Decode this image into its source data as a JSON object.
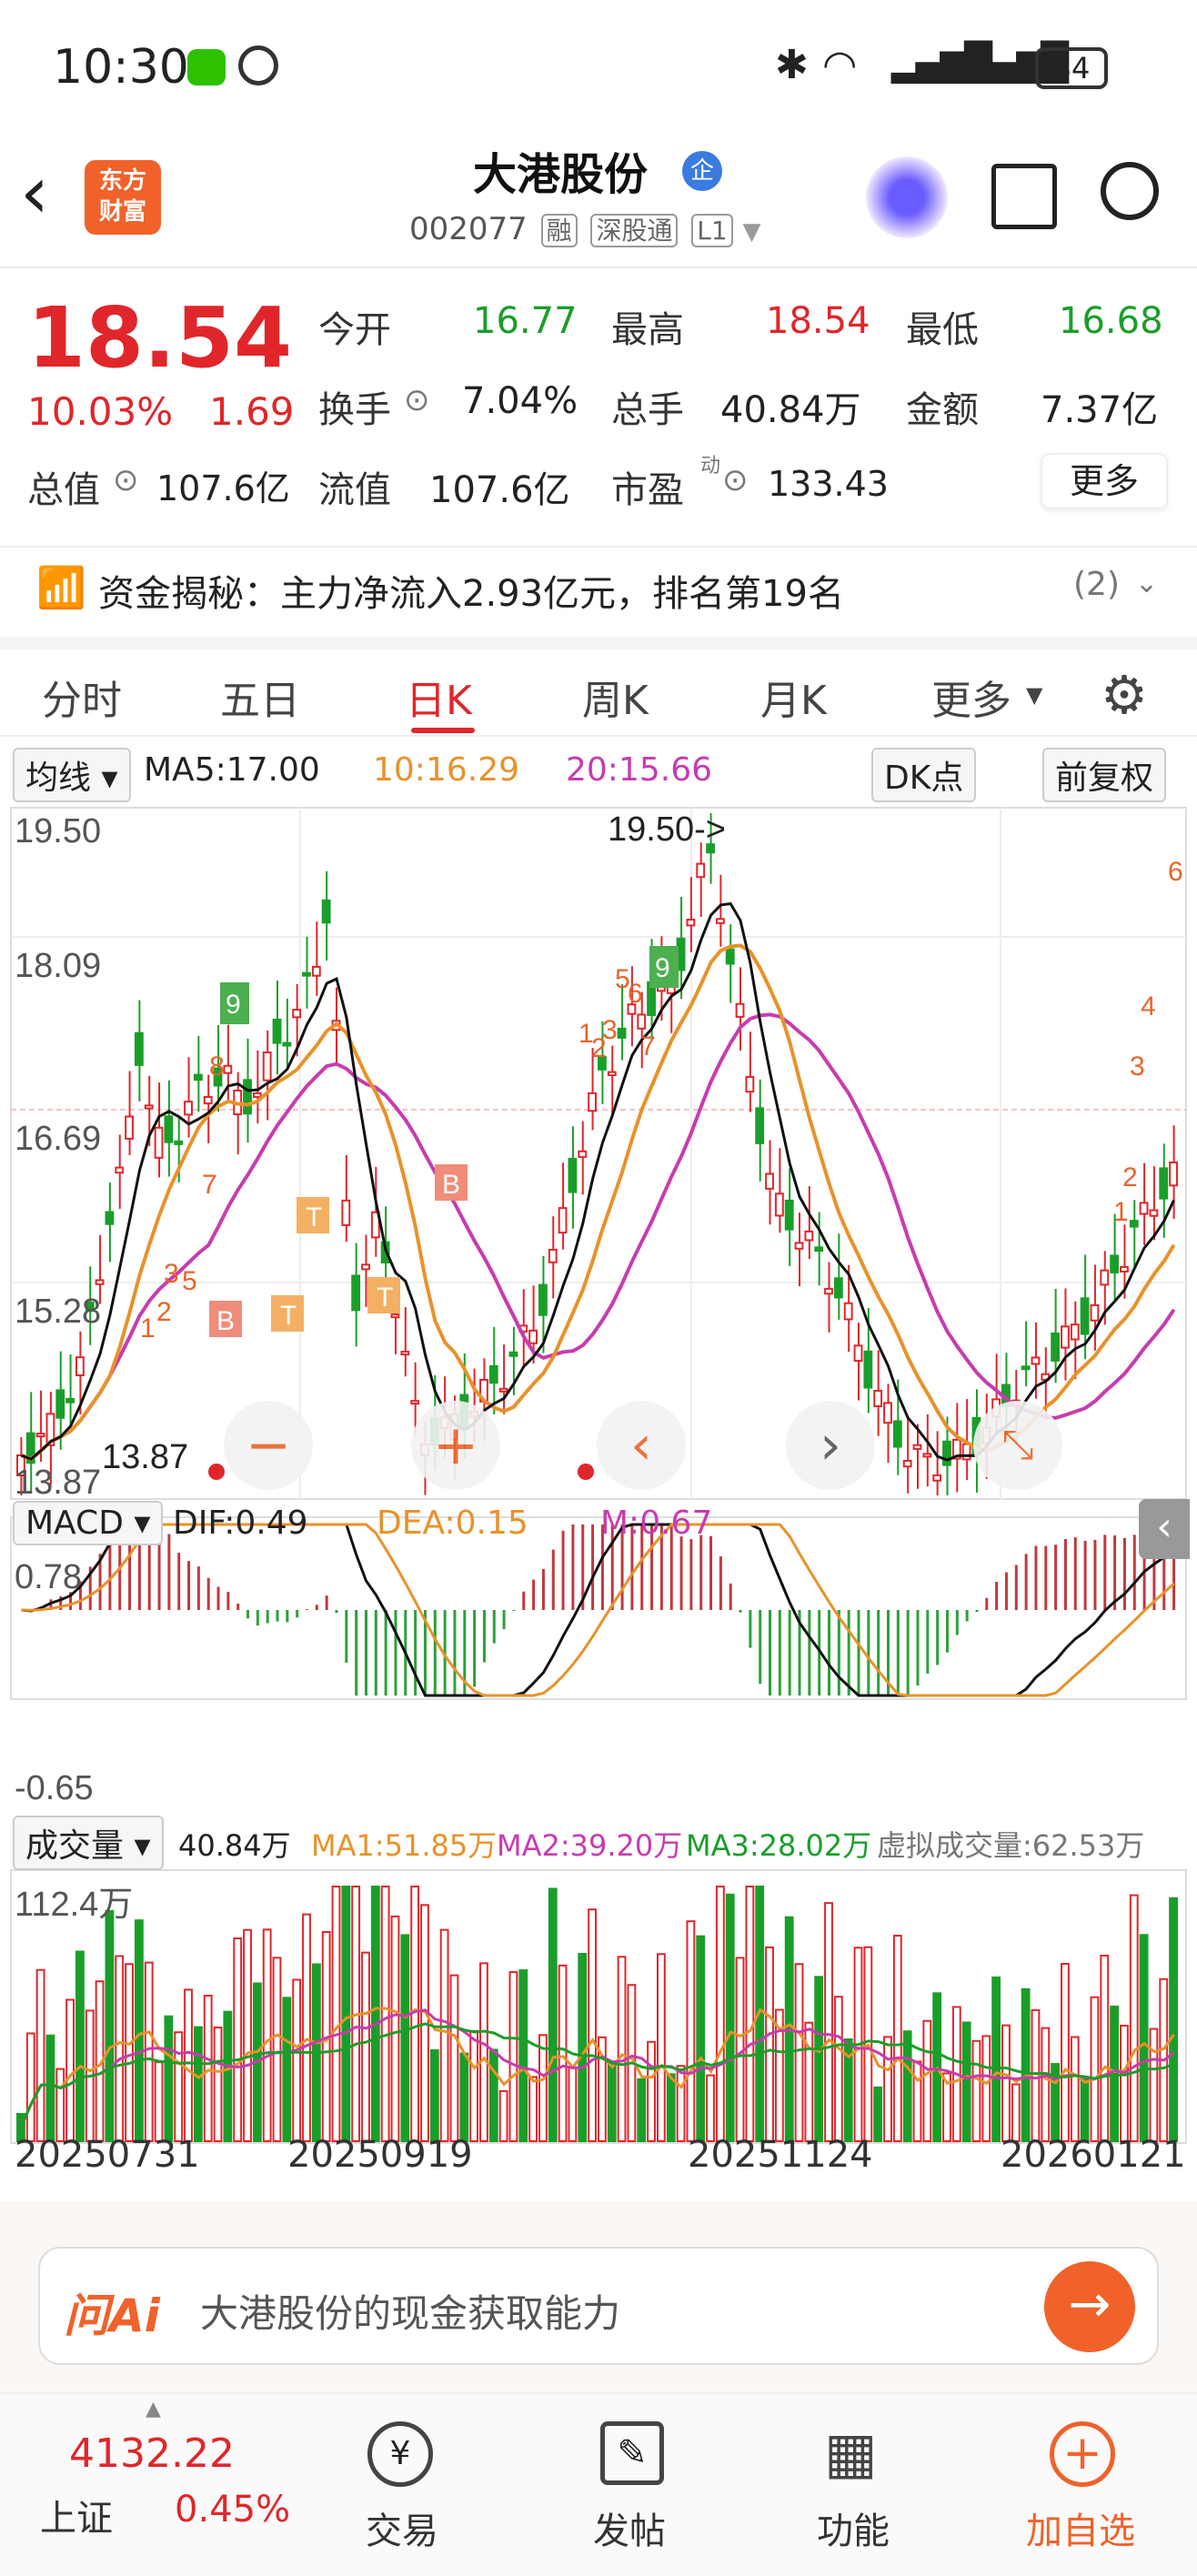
{
  "status": {
    "time": "10:30",
    "battery": "84"
  },
  "header": {
    "logo_line1": "东方",
    "logo_line2": "财富",
    "title": "大港股份",
    "badge": "企",
    "code": "002077",
    "tags": [
      "融",
      "深股通",
      "L1"
    ]
  },
  "quote": {
    "price": "18.54",
    "pct": "10.03%",
    "chg": "1.69",
    "open_label": "今开",
    "open": "16.77",
    "high_label": "最高",
    "high": "18.54",
    "low_label": "最低",
    "low": "16.68",
    "turnover_label": "换手",
    "turnover": "7.04%",
    "volume_label": "总手",
    "volume": "40.84万",
    "amount_label": "金额",
    "amount": "7.37亿",
    "mktcap_label": "总值",
    "mktcap": "107.6亿",
    "float_label": "流值",
    "float": "107.6亿",
    "pe_label": "市盈",
    "pe_super": "动",
    "pe": "133.43",
    "more": "更多"
  },
  "capital": {
    "text": "资金揭秘：主力净流入2.93亿元，排名第19名",
    "count": "(2)"
  },
  "tabs": [
    "分时",
    "五日",
    "日K",
    "周K",
    "月K",
    "更多"
  ],
  "kline": {
    "ma_selector": "均线",
    "ma5": "MA5:17.00",
    "ma10": "10:16.29",
    "ma20": "20:15.66",
    "dk": "DK点",
    "adjust": "前复权",
    "y_labels": [
      "19.50",
      "18.09",
      "16.69",
      "15.28",
      "13.87"
    ],
    "peak_label": "19.50->",
    "low_label": "13.87"
  },
  "macd": {
    "selector": "MACD",
    "dif": "DIF:0.49",
    "dea": "DEA:0.15",
    "m": "M:0.67",
    "y_top": "0.78",
    "y_bottom": "-0.65"
  },
  "volume": {
    "selector": "成交量",
    "value": "40.84万",
    "ma1": "MA1:51.85万",
    "ma2": "MA2:39.20万",
    "ma3": "MA3:28.02万",
    "virtual": "虚拟成交量:62.53万",
    "y_top": "112.4万"
  },
  "dates": [
    "20250731",
    "20250919",
    "20251124",
    "20260121"
  ],
  "ask": {
    "brand": "问Ai",
    "placeholder": "大港股份的现金获取能力"
  },
  "bottom_nav": {
    "index_value": "4132.22",
    "index_name": "上证",
    "index_pct": "0.45%",
    "items": [
      "交易",
      "发帖",
      "功能",
      "加自选"
    ]
  },
  "colors": {
    "up": "#e0262b",
    "down": "#1a9e2a",
    "ma10": "#e8922a",
    "ma20": "#c73caf",
    "accent": "#f0622a"
  }
}
